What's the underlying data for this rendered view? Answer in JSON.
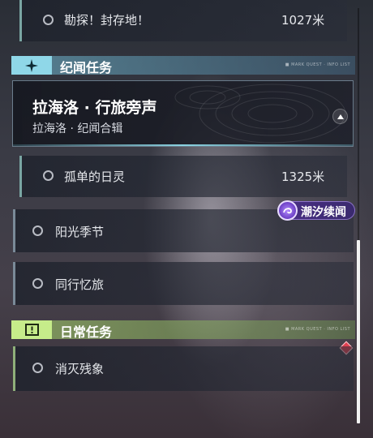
{
  "quests_top": [
    {
      "name": "勘探！封存地！",
      "distance": "1027米"
    }
  ],
  "section_story": {
    "label": "纪闻任务",
    "tiny_text": "■ MARK QUEST · INFO LIST",
    "accent": "#8fd7e8",
    "featured": {
      "title": "拉海洛 · 行旅旁声",
      "subtitle": "拉海洛 · 纪闻合辑"
    },
    "sub_quests": [
      {
        "name": "孤单的日灵",
        "distance": "1325米"
      }
    ],
    "quests": [
      {
        "name": "阳光季节"
      },
      {
        "name": "同行忆旅"
      }
    ]
  },
  "tide_badge": {
    "label": "潮汐续闻",
    "color": "#5a3aa0"
  },
  "section_daily": {
    "label": "日常任务",
    "tiny_text": "■ MARK QUEST · INFO LIST",
    "accent": "#c6ec8a",
    "quests": [
      {
        "name": "消灭残象"
      }
    ]
  },
  "icons": {
    "story_icon": "sparkle-star-icon",
    "daily_icon": "exclamation-box-icon",
    "quest_status": "hollow-circle-icon",
    "collapse": "chevron-up-icon",
    "tracking_marker": "red-diamond-icon"
  }
}
